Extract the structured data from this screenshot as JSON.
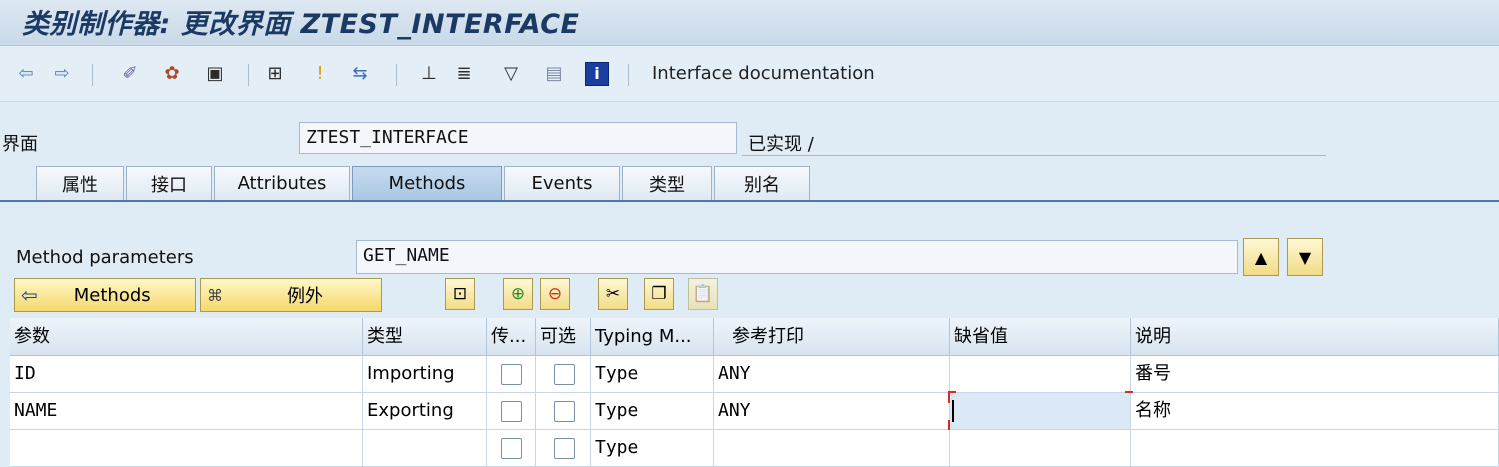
{
  "window": {
    "title": "类别制作器: 更改界面 ZTEST_INTERFACE"
  },
  "toolbar": {
    "doc_label": "Interface documentation",
    "icons": [
      "back-arrow",
      "forward-arrow",
      "edit-wand",
      "activate",
      "object-list",
      "hierarchy",
      "where-used",
      "navigate",
      "class-hierarchy",
      "pattern",
      "filter",
      "display",
      "info"
    ]
  },
  "header": {
    "interface_label": "界面",
    "interface_value": "ZTEST_INTERFACE",
    "status": "已实现 /"
  },
  "tabs": [
    {
      "label": "属性"
    },
    {
      "label": "接口"
    },
    {
      "label": "Attributes"
    },
    {
      "label": "Methods",
      "active": true
    },
    {
      "label": "Events"
    },
    {
      "label": "类型"
    },
    {
      "label": "别名"
    }
  ],
  "params": {
    "label": "Method parameters",
    "value": "GET_NAME"
  },
  "buttons": {
    "methods": "Methods",
    "exceptions": "例外"
  },
  "table": {
    "columns": [
      "参数",
      "类型",
      "传...",
      "可选",
      "Typing M...",
      "参考打印",
      "缺省值",
      "说明"
    ],
    "rows": [
      {
        "param": "ID",
        "type": "Importing",
        "typing": "Type",
        "ref": "ANY",
        "default": "",
        "desc": "番号"
      },
      {
        "param": "NAME",
        "type": "Exporting",
        "typing": "Type",
        "ref": "ANY",
        "default": "",
        "desc": "名称"
      },
      {
        "param": "",
        "type": "",
        "typing": "Type",
        "ref": "",
        "default": "",
        "desc": ""
      }
    ]
  },
  "colors": {
    "accent": "#4a78b0",
    "button": "#f4d96b",
    "title": "#1b3a63"
  }
}
